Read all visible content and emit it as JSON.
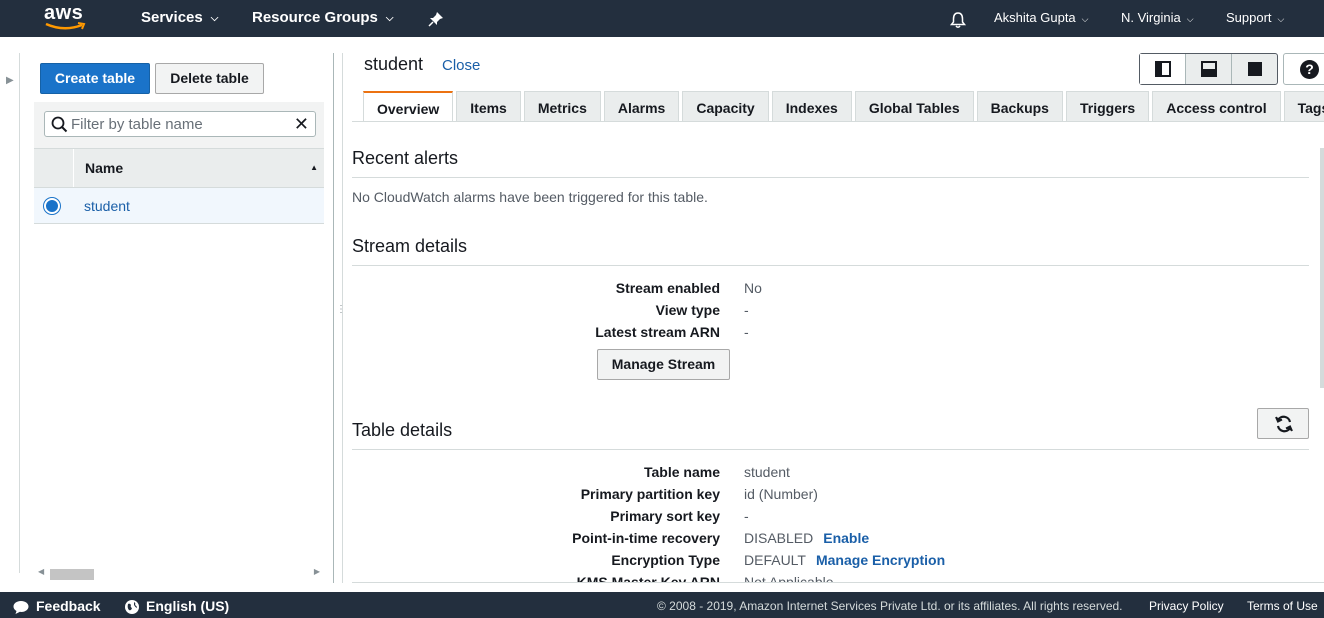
{
  "topnav": {
    "logo": "aws",
    "services": "Services",
    "resource_groups": "Resource Groups",
    "pin_icon": "pin-icon",
    "bell_icon": "bell-icon",
    "user": "Akshita Gupta",
    "region": "N. Virginia",
    "support": "Support"
  },
  "left": {
    "create_table": "Create table",
    "delete_table": "Delete table",
    "filter_placeholder": "Filter by table name",
    "column_name": "Name",
    "rows": [
      {
        "name": "student",
        "selected": true
      }
    ]
  },
  "detail": {
    "table_title": "student",
    "close": "Close",
    "tabs": [
      "Overview",
      "Items",
      "Metrics",
      "Alarms",
      "Capacity",
      "Indexes",
      "Global Tables",
      "Backups",
      "Triggers",
      "Access control",
      "Tags"
    ],
    "active_tab": "Overview",
    "recent_alerts": {
      "title": "Recent alerts",
      "message": "No CloudWatch alarms have been triggered for this table."
    },
    "stream_details": {
      "title": "Stream details",
      "rows": [
        {
          "key": "Stream enabled",
          "value": "No"
        },
        {
          "key": "View type",
          "value": "-"
        },
        {
          "key": "Latest stream ARN",
          "value": "-"
        }
      ],
      "manage_stream": "Manage Stream"
    },
    "table_details": {
      "title": "Table details",
      "rows": [
        {
          "key": "Table name",
          "value": "student"
        },
        {
          "key": "Primary partition key",
          "value": "id (Number)"
        },
        {
          "key": "Primary sort key",
          "value": "-"
        },
        {
          "key": "Point-in-time recovery",
          "value": "DISABLED",
          "link": "Enable"
        },
        {
          "key": "Encryption Type",
          "value": "DEFAULT",
          "link": "Manage Encryption"
        },
        {
          "key": "KMS Master Key ARN",
          "value": "Not Applicable"
        }
      ]
    }
  },
  "footer": {
    "feedback": "Feedback",
    "language": "English (US)",
    "copyright": "© 2008 - 2019, Amazon Internet Services Private Ltd. or its affiliates. All rights reserved.",
    "privacy": "Privacy Policy",
    "terms": "Terms of Use"
  },
  "colors": {
    "nav_bg": "#232f3e",
    "primary_button": "#1a73c9",
    "link": "#1a5fa8",
    "active_tab_accent": "#ec7211"
  }
}
